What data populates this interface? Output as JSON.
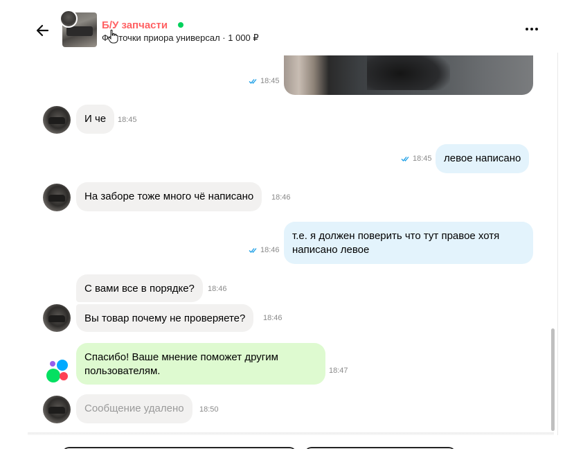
{
  "header": {
    "seller_name": "Б/У запчасти",
    "item_line": "Фонточки приора универсал · 1 000 ₽",
    "online": true
  },
  "colors": {
    "seller_name": "#ff6163",
    "online": "#02d15c",
    "bubble_in": "#f2f1f0",
    "bubble_out": "#e3f3fc",
    "bubble_system": "#defad0",
    "ticks": "#1a9ee6"
  },
  "icons": {
    "back": "arrow-left-icon",
    "more": "more-dots-icon",
    "read": "double-check-icon"
  },
  "messages": [
    {
      "type": "photo",
      "direction": "out",
      "time": "18:45"
    },
    {
      "direction": "in",
      "text": "И че",
      "time": "18:45"
    },
    {
      "direction": "out",
      "text": "левое написано",
      "time": "18:45"
    },
    {
      "direction": "in",
      "text": "На заборе тоже много чё написано",
      "time": "18:46"
    },
    {
      "direction": "out",
      "text": "т.е. я должен поверить что тут правое хотя написано левое",
      "time": "18:46"
    },
    {
      "direction": "in",
      "text": "С вами все в порядке?",
      "time": "18:46"
    },
    {
      "direction": "in",
      "text": "Вы товар почему не проверяете?",
      "time": "18:46"
    },
    {
      "direction": "system",
      "text": "Спасибо! Ваше мнение поможет другим пользователям.",
      "time": "18:47"
    },
    {
      "direction": "in",
      "deleted": true,
      "text": "Сообщение удалено",
      "time": "18:50"
    }
  ]
}
